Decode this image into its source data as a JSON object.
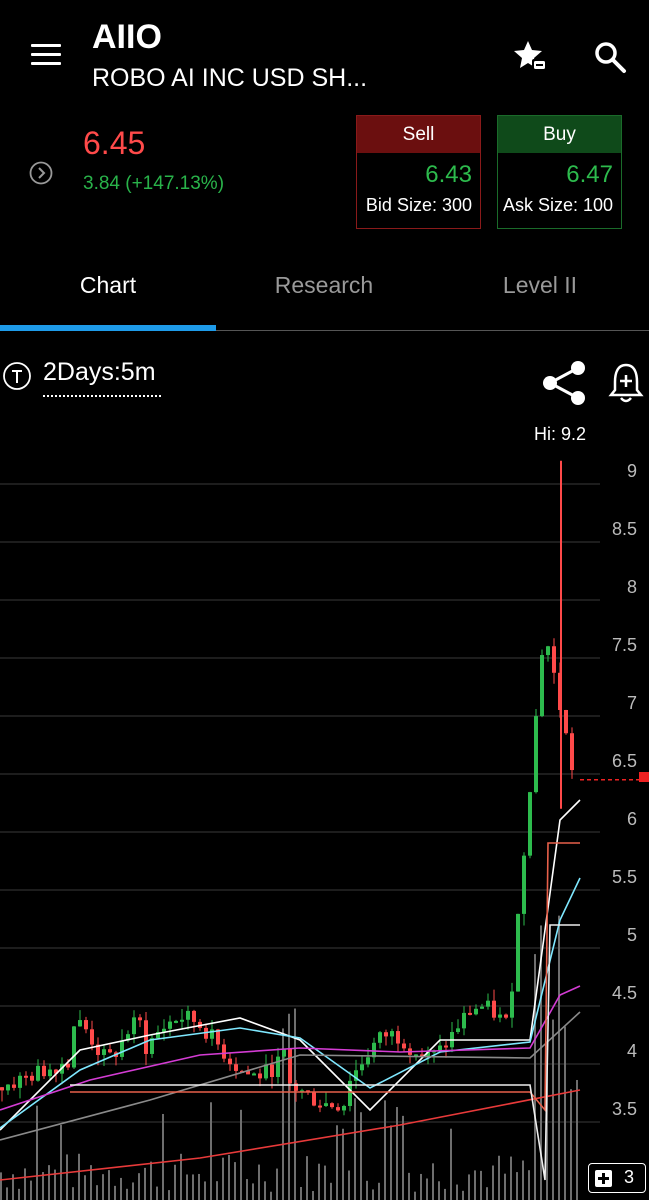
{
  "header": {
    "symbol": "AIIO",
    "name": "ROBO AI INC USD SH...",
    "icons": [
      "menu-icon",
      "watchlist-star-icon",
      "search-icon"
    ]
  },
  "quote": {
    "last": "6.45",
    "change": "3.84 (+147.13%)",
    "sell": {
      "label": "Sell",
      "price": "6.43",
      "size": "Bid Size: 300"
    },
    "buy": {
      "label": "Buy",
      "price": "6.47",
      "size": "Ask Size: 100"
    }
  },
  "tabs": [
    {
      "label": "Chart",
      "active": true
    },
    {
      "label": "Research",
      "active": false
    },
    {
      "label": "Level II",
      "active": false
    }
  ],
  "chart_toolbar": {
    "timeframe": "2Days:5m",
    "hi_label": "Hi: 9.2"
  },
  "indicator_count": "3",
  "colors": {
    "price_up": "#2dbb4d",
    "price_down": "#ff4a4a",
    "tab_underline": "#1e9be9",
    "sell_header": "#6b0f0f",
    "buy_header": "#0f4a1a"
  },
  "chart_data": {
    "type": "candlestick",
    "y_ticks": [
      "9",
      "8.5",
      "8",
      "7.5",
      "7",
      "6.5",
      "6",
      "5.5",
      "5",
      "4.5",
      "4",
      "3.5"
    ],
    "ylim": [
      3.3,
      9.3
    ],
    "high": 9.2,
    "last": 6.45,
    "grid": true
  }
}
